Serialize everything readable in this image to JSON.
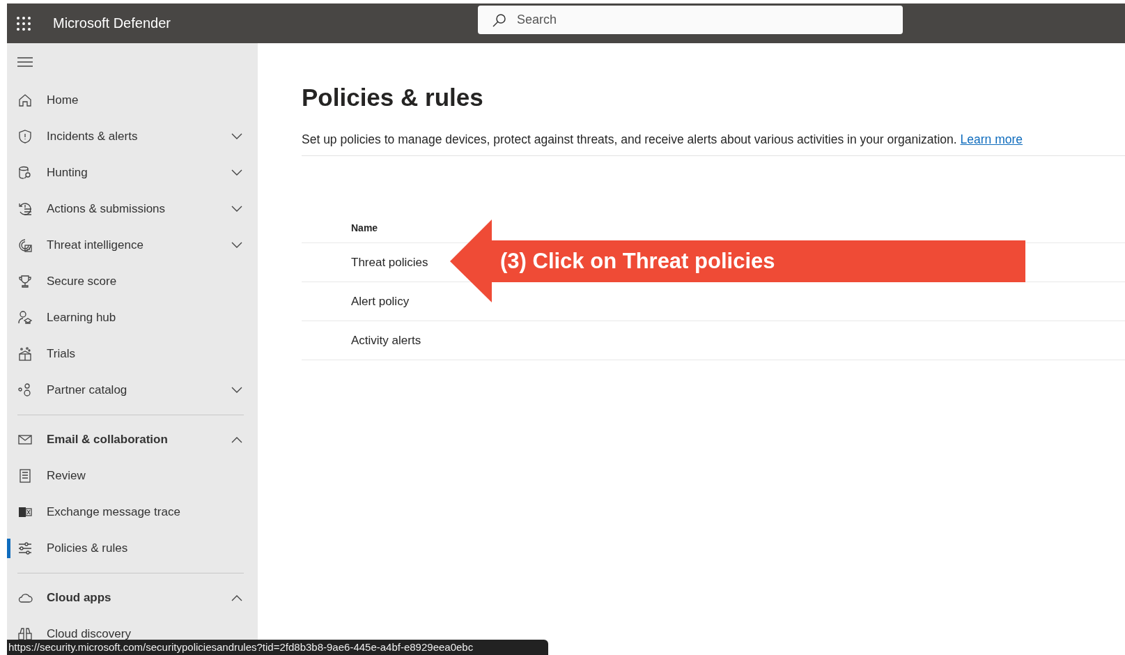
{
  "app": {
    "title": "Microsoft Defender"
  },
  "search": {
    "placeholder": "Search"
  },
  "nav": [
    {
      "label": "Home",
      "kind": "link",
      "selected": false
    },
    {
      "label": "Incidents & alerts",
      "kind": "group",
      "expanded": false,
      "selected": false
    },
    {
      "label": "Hunting",
      "kind": "group",
      "expanded": false,
      "selected": false
    },
    {
      "label": "Actions & submissions",
      "kind": "group",
      "expanded": false,
      "selected": false
    },
    {
      "label": "Threat intelligence",
      "kind": "group",
      "expanded": false,
      "selected": false
    },
    {
      "label": "Secure score",
      "kind": "link",
      "selected": false
    },
    {
      "label": "Learning hub",
      "kind": "link",
      "selected": false
    },
    {
      "label": "Trials",
      "kind": "link",
      "selected": false
    },
    {
      "label": "Partner catalog",
      "kind": "group",
      "expanded": false,
      "selected": false
    },
    {
      "label": "Email & collaboration",
      "kind": "section",
      "expanded": true,
      "selected": false
    },
    {
      "label": "Review",
      "kind": "link",
      "selected": false
    },
    {
      "label": "Exchange message trace",
      "kind": "link",
      "selected": false
    },
    {
      "label": "Policies & rules",
      "kind": "link",
      "selected": true
    },
    {
      "label": "Cloud apps",
      "kind": "section",
      "expanded": true,
      "selected": false
    },
    {
      "label": "Cloud discovery",
      "kind": "link",
      "selected": false
    }
  ],
  "page": {
    "title": "Policies & rules",
    "description": "Set up policies to manage devices, protect against threats, and receive alerts about various activities in your organization.",
    "link": "Learn more"
  },
  "table": {
    "columns": [
      "Name"
    ],
    "rows": [
      "Threat policies",
      "Alert policy",
      "Activity alerts"
    ]
  },
  "callout": {
    "text": "(3) Click on Threat policies"
  },
  "status_bar": {
    "url": "https://security.microsoft.com/securitypoliciesandrules?tid=2fd8b3b8-9ae6-445e-a4bf-e8929eea0ebc"
  }
}
